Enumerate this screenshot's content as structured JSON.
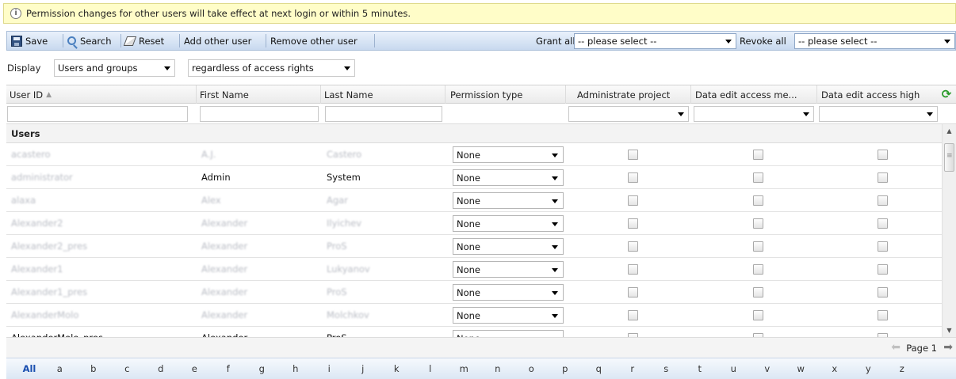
{
  "info_banner": {
    "icon": "info-icon",
    "text": "Permission changes for other users will take effect at next login or within 5 minutes."
  },
  "toolbar": {
    "save_label": "Save",
    "search_label": "Search",
    "reset_label": "Reset",
    "add_user_label": "Add other user",
    "remove_user_label": "Remove other user",
    "grant_all_label": "Grant all",
    "grant_all_value": "-- please select --",
    "revoke_all_label": "Revoke all",
    "revoke_all_value": "-- please select --"
  },
  "display_filter": {
    "label": "Display",
    "mode_value": "Users and groups",
    "access_value": "regardless of access rights"
  },
  "columns": [
    "User ID",
    "First Name",
    "Last Name",
    "Permission type",
    "Administrate project",
    "Data edit access me...",
    "Data edit access high"
  ],
  "group_label": "Users",
  "rows": [
    {
      "user_id": "acastero",
      "first": "A.J.",
      "last": "Castero",
      "perm": "None",
      "blur_id": true,
      "blur_first": true,
      "blur_last": true
    },
    {
      "user_id": "administrator",
      "first": "Admin",
      "last": "System",
      "perm": "None",
      "blur_id": true,
      "blur_first": false,
      "blur_last": false
    },
    {
      "user_id": "alaxa",
      "first": "Alex",
      "last": "Agar",
      "perm": "None",
      "blur_id": true,
      "blur_first": true,
      "blur_last": true
    },
    {
      "user_id": "Alexander2",
      "first": "Alexander",
      "last": "Ilyichev",
      "perm": "None",
      "blur_id": true,
      "blur_first": true,
      "blur_last": true
    },
    {
      "user_id": "Alexander2_pres",
      "first": "Alexander",
      "last": "ProS",
      "perm": "None",
      "blur_id": true,
      "blur_first": true,
      "blur_last": true
    },
    {
      "user_id": "Alexander1",
      "first": "Alexander",
      "last": "Lukyanov",
      "perm": "None",
      "blur_id": true,
      "blur_first": true,
      "blur_last": true
    },
    {
      "user_id": "Alexander1_pres",
      "first": "Alexander",
      "last": "ProS",
      "perm": "None",
      "blur_id": true,
      "blur_first": true,
      "blur_last": true
    },
    {
      "user_id": "AlexanderMolo",
      "first": "Alexander",
      "last": "Molchkov",
      "perm": "None",
      "blur_id": true,
      "blur_first": true,
      "blur_last": true
    },
    {
      "user_id": "AlexanderMolo_pres",
      "first": "Alexander",
      "last": "ProS",
      "perm": "None",
      "blur_id": false,
      "blur_first": false,
      "blur_last": false
    }
  ],
  "pager": {
    "label": "Page 1"
  },
  "alphabet": [
    "All",
    "a",
    "b",
    "c",
    "d",
    "e",
    "f",
    "g",
    "h",
    "i",
    "j",
    "k",
    "l",
    "m",
    "n",
    "o",
    "p",
    "q",
    "r",
    "s",
    "t",
    "u",
    "v",
    "w",
    "x",
    "y",
    "z"
  ]
}
